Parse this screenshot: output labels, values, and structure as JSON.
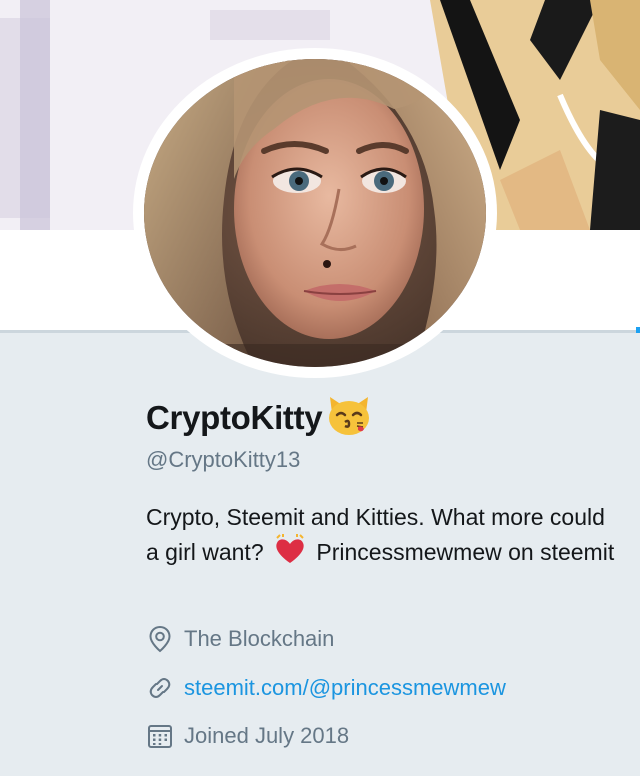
{
  "profile": {
    "display_name": "CryptoKitty",
    "display_name_emoji": "kissing-cat-emoji",
    "handle": "@CryptoKitty13",
    "bio": {
      "part1": "Crypto, Steemit and Kitties. What more could a girl want?",
      "heart_emoji": "heart-emoji",
      "part2": "Princessmewmew on steemit"
    },
    "location": "The Blockchain",
    "website": "steemit.com/@princessmewmew",
    "joined": "Joined July 2018"
  },
  "icons": {
    "location": "location-pin-icon",
    "website": "link-icon",
    "joined": "calendar-icon"
  },
  "colors": {
    "background": "#e6ecf0",
    "text_primary": "#14171a",
    "text_secondary": "#657786",
    "link": "#1b95e0",
    "accent": "#1da1f2"
  }
}
